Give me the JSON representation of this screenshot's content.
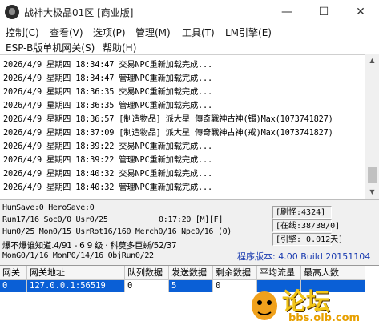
{
  "window": {
    "title": "战神大极品01区 [商业版]",
    "minimize": "—",
    "maximize": "☐",
    "close": "✕"
  },
  "menu": {
    "row1": [
      "控制(C)",
      "查看(V)",
      "选项(P)",
      "管理(M)",
      "工具(T)",
      "LM引擎(E)"
    ],
    "row2": [
      "ESP-B版单机网关(S)",
      "帮助(H)"
    ]
  },
  "log": [
    "2026/4/9 星期四 18:34:47 交易NPC重新加载完成...",
    "2026/4/9 星期四 18:34:47 管理NPC重新加载完成...",
    "2026/4/9 星期四 18:36:35 交易NPC重新加载完成...",
    "2026/4/9 星期四 18:36:35 管理NPC重新加载完成...",
    "2026/4/9 星期四 18:36:57 [制造物品] 派大星 傳奇戰神古神(镯)Max(1073741827)",
    "2026/4/9 星期四 18:37:09 [制造物品] 派大星 傳奇戰神古神(戒)Max(1073741827)",
    "2026/4/9 星期四 18:39:22 交易NPC重新加载完成...",
    "2026/4/9 星期四 18:39:22 管理NPC重新加载完成...",
    "2026/4/9 星期四 18:40:32 交易NPC重新加载完成...",
    "2026/4/9 星期四 18:40:32 管理NPC重新加载完成..."
  ],
  "status": {
    "line1": "HumSave:0 HeroSave:0",
    "line2": "Run17/16 Soc0/0 Usr0/25",
    "time": "0:17:20 [M][F]",
    "line3": "Hum0/25 Mon0/15 UsrRot16/160 Merch0/16 Npc0/16 (0)",
    "line4": "爆不爆谁知道.4/91 - 6 9 级 · 科莫多巨蜥/52/37",
    "line5": "MonG0/1/16 MonP0/14/16 ObjRun0/22",
    "refresh": "[刷怪:4324]",
    "online": "[在线:38/38/0]",
    "engine": "[引擎: 0.012天]",
    "version": "程序版本: 4.00 Build 20151104"
  },
  "table": {
    "headers": [
      "网关",
      "网关地址",
      "队列数据",
      "发送数据",
      "剩余数据",
      "平均流量",
      "最高人数"
    ],
    "rows": [
      [
        "0",
        "127.0.0.1:56519",
        "0",
        "5",
        "0",
        "",
        ""
      ]
    ]
  },
  "watermark": {
    "logo": "论坛",
    "url": "bbs.olb.com"
  }
}
